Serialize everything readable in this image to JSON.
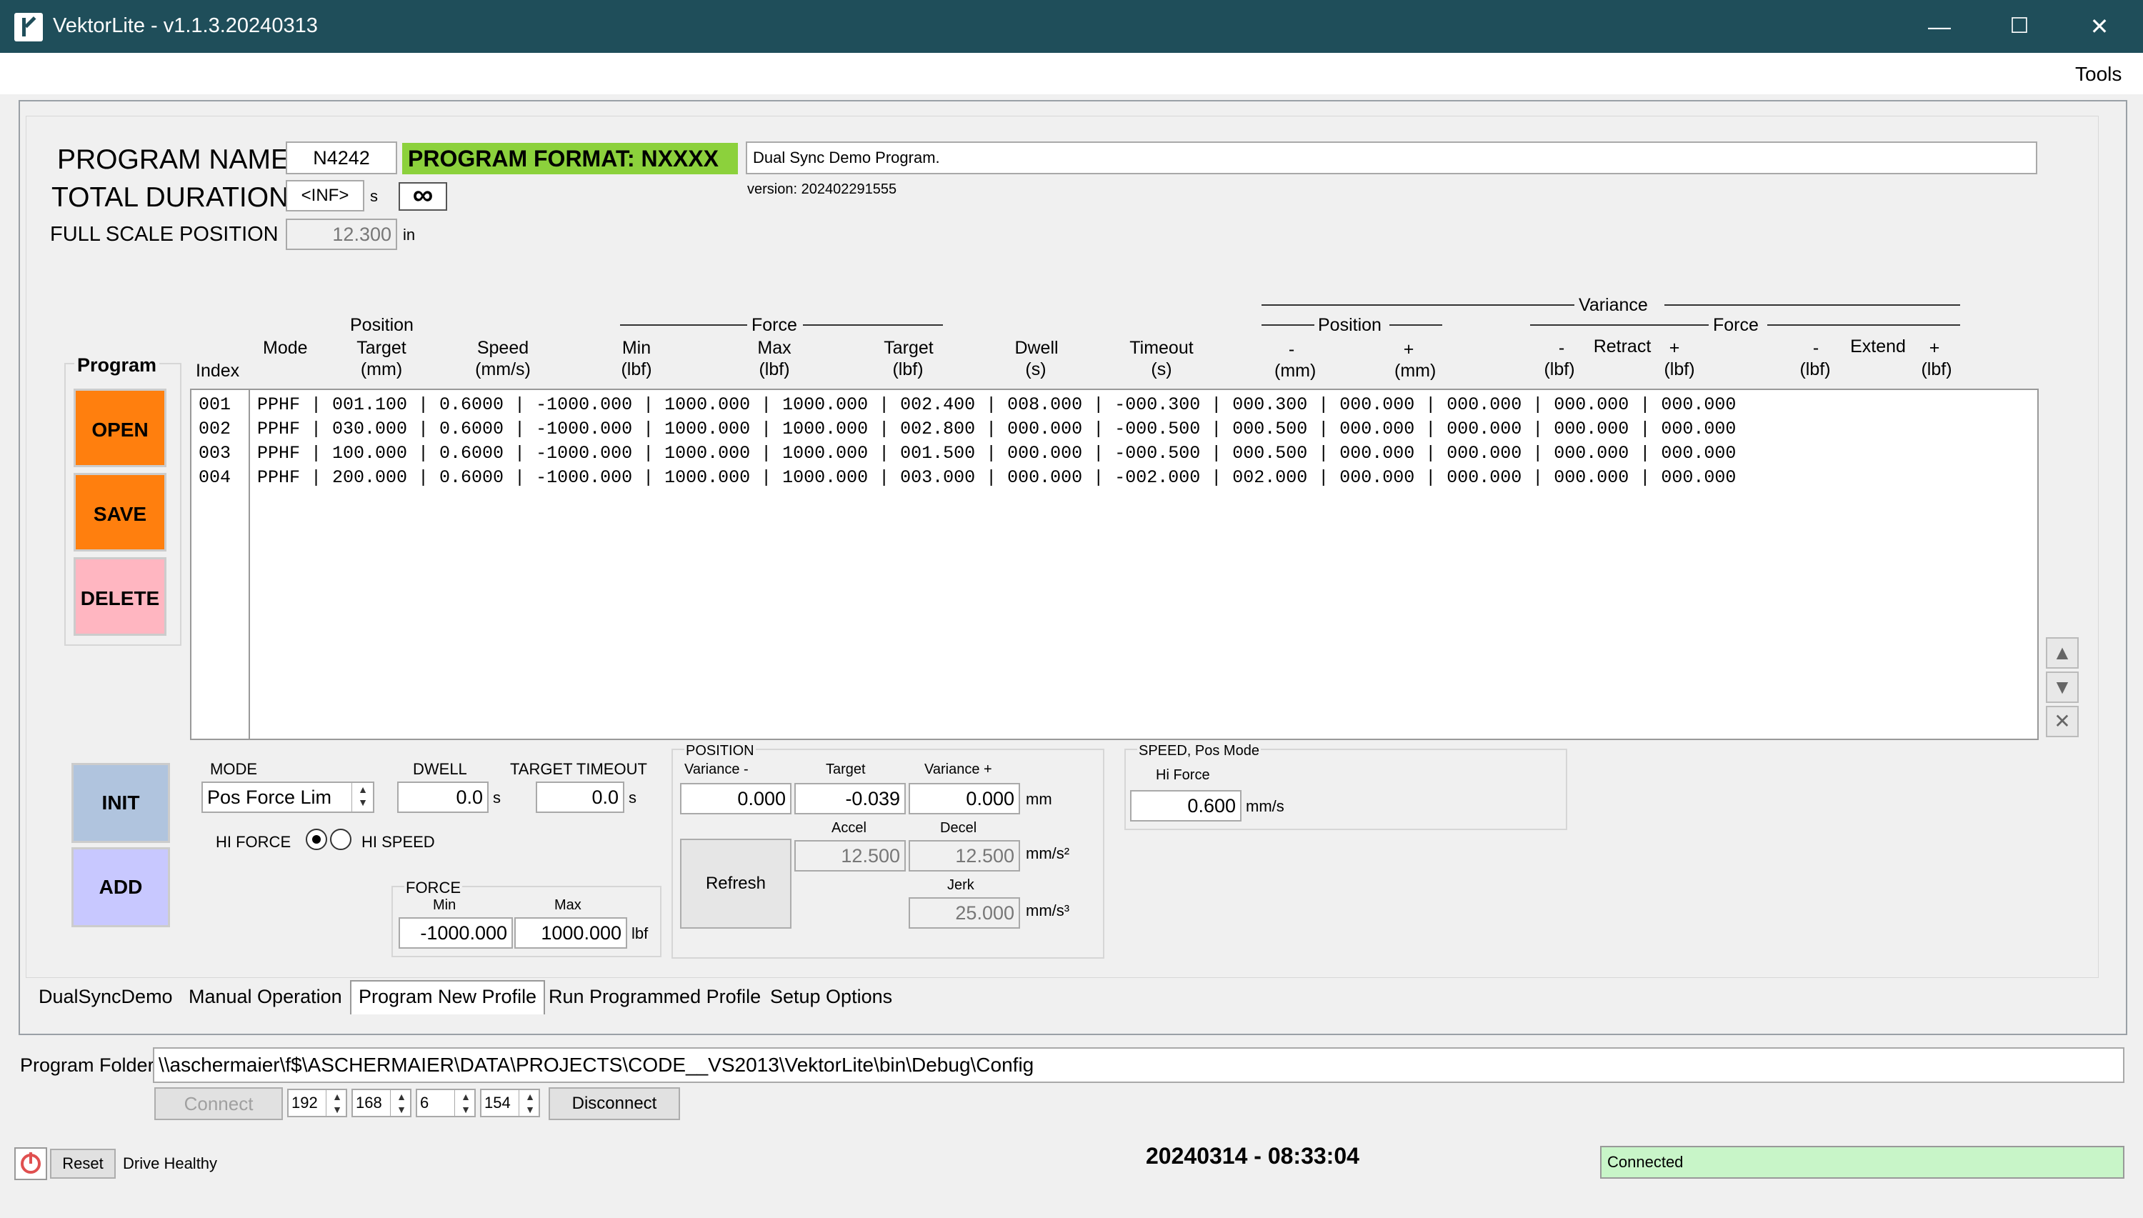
{
  "window": {
    "title": "VektorLite - v1.1.3.20240313",
    "minimize": "—",
    "maximize": "☐",
    "close": "✕"
  },
  "menu": {
    "tools": "Tools"
  },
  "header": {
    "program_name_label": "PROGRAM NAME",
    "program_name_value": "N4242",
    "program_format": "PROGRAM FORMAT: NXXXX",
    "description": "Dual Sync Demo Program.",
    "version": "version: 202402291555",
    "total_duration_label": "TOTAL DURATION",
    "total_duration_value": "<INF>",
    "total_duration_unit": "s",
    "infinity_symbol": "∞",
    "full_scale_label": "FULL SCALE POSITION",
    "full_scale_value": "12.300",
    "full_scale_unit": "in"
  },
  "columns": {
    "program": "Program",
    "index": "Index",
    "mode": "Mode",
    "position_group": "Position",
    "target": "Target",
    "mm": "(mm)",
    "speed": "Speed",
    "mms": "(mm/s)",
    "force_group": "Force",
    "min": "Min",
    "max": "Max",
    "target2": "Target",
    "lbf": "(lbf)",
    "dwell": "Dwell",
    "s": "(s)",
    "timeout": "Timeout",
    "variance": "Variance",
    "var_position": "Position",
    "minus": "-",
    "plus": "+",
    "var_force": "Force",
    "retract": "Retract",
    "extend": "Extend"
  },
  "rows": [
    {
      "index": "001",
      "data": "PPHF | 001.100 | 0.6000 | -1000.000 | 1000.000 | 1000.000 | 002.400 | 008.000 | -000.300 | 000.300 | 000.000 | 000.000 | 000.000 | 000.000"
    },
    {
      "index": "002",
      "data": "PPHF | 030.000 | 0.6000 | -1000.000 | 1000.000 | 1000.000 | 002.800 | 000.000 | -000.500 | 000.500 | 000.000 | 000.000 | 000.000 | 000.000"
    },
    {
      "index": "003",
      "data": "PPHF | 100.000 | 0.6000 | -1000.000 | 1000.000 | 1000.000 | 001.500 | 000.000 | -000.500 | 000.500 | 000.000 | 000.000 | 000.000 | 000.000"
    },
    {
      "index": "004",
      "data": "PPHF | 200.000 | 0.6000 | -1000.000 | 1000.000 | 1000.000 | 003.000 | 000.000 | -002.000 | 002.000 | 000.000 | 000.000 | 000.000 | 000.000"
    }
  ],
  "buttons": {
    "open": "OPEN",
    "save": "SAVE",
    "delete": "DELETE",
    "init": "INIT",
    "add": "ADD",
    "refresh": "Refresh",
    "connect": "Connect",
    "disconnect": "Disconnect",
    "reset": "Reset"
  },
  "scroll": {
    "up": "▲",
    "down": "▼",
    "clear": "✕"
  },
  "editor": {
    "mode_label": "MODE",
    "mode_value": "Pos Force Lim",
    "dwell_label": "DWELL",
    "dwell_value": "0.0",
    "dwell_unit": "s",
    "timeout_label": "TARGET TIMEOUT",
    "timeout_value": "0.0",
    "timeout_unit": "s",
    "hi_force": "HI FORCE",
    "hi_speed": "HI SPEED",
    "force_label": "FORCE",
    "force_min_label": "Min",
    "force_max_label": "Max",
    "force_min": "-1000.000",
    "force_max": "1000.000",
    "force_unit": "lbf",
    "position_label": "POSITION",
    "var_minus_label": "Variance -",
    "target_label": "Target",
    "var_plus_label": "Variance +",
    "var_minus": "0.000",
    "target": "-0.039",
    "var_plus": "0.000",
    "pos_unit": "mm",
    "accel_label": "Accel",
    "decel_label": "Decel",
    "accel": "12.500",
    "decel": "12.500",
    "accel_unit": "mm/s²",
    "jerk_label": "Jerk",
    "jerk": "25.000",
    "jerk_unit": "mm/s³",
    "speed_label": "SPEED, Pos Mode",
    "hi_force_label": "Hi Force",
    "speed_value": "0.600",
    "speed_unit": "mm/s"
  },
  "tabs": [
    "DualSyncDemo",
    "Manual Operation",
    "Program New Profile",
    "Run Programmed Profile",
    "Setup Options"
  ],
  "footer": {
    "program_folder_label": "Program Folder",
    "program_folder": "\\\\aschermaier\\f$\\ASCHERMAIER\\DATA\\PROJECTS\\CODE__VS2013\\VektorLite\\bin\\Debug\\Config",
    "ip1": "192",
    "ip2": "168",
    "ip3": "6",
    "ip4": "154",
    "drive_status": "Drive Healthy",
    "timestamp": "20240314 - 08:33:04",
    "connection": "Connected"
  }
}
